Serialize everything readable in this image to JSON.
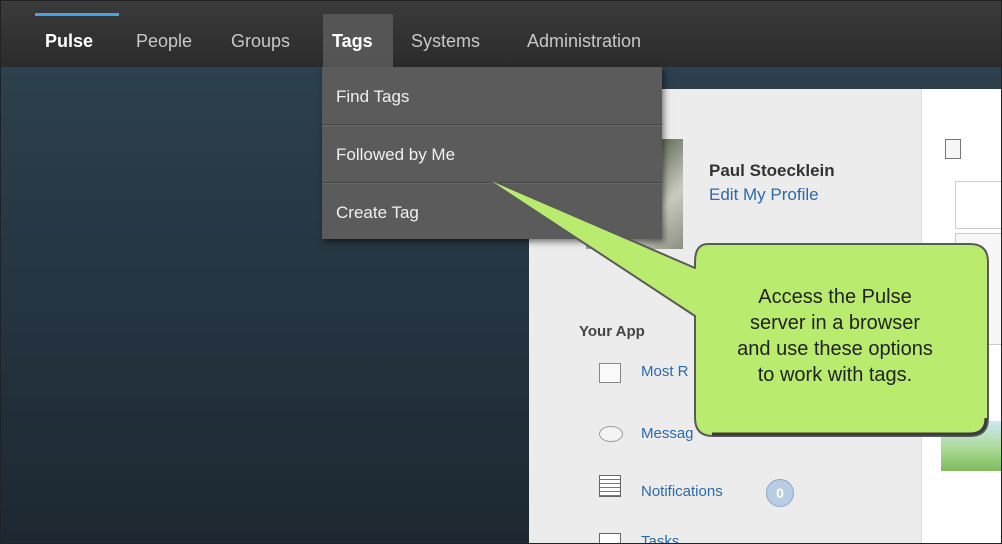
{
  "nav": {
    "items": [
      {
        "label": "Pulse"
      },
      {
        "label": "People"
      },
      {
        "label": "Groups"
      },
      {
        "label": "Tags"
      },
      {
        "label": "Systems"
      },
      {
        "label": "Administration"
      }
    ],
    "active": "Pulse",
    "open_menu": "Tags"
  },
  "tags_menu": {
    "items": [
      {
        "label": "Find Tags"
      },
      {
        "label": "Followed by Me"
      },
      {
        "label": "Create Tag"
      }
    ]
  },
  "profile": {
    "name": "Paul Stoecklein",
    "edit_label": "Edit My Profile"
  },
  "apps": {
    "heading": "Your App",
    "items": [
      {
        "label": "Most R",
        "icon": "document-icon"
      },
      {
        "label": "Messag",
        "icon": "message-icon"
      },
      {
        "label": "Notifications",
        "icon": "notifications-icon",
        "badge": "0"
      },
      {
        "label": "Tasks",
        "icon": "tasks-icon"
      }
    ]
  },
  "callout": {
    "text_lines": [
      "Access the Pulse",
      "server in a browser",
      "and use these options",
      "to work with tags."
    ]
  },
  "colors": {
    "navbar": "#2f2f2f",
    "accent": "#4aa3df",
    "menu_bg": "#5b5b5b",
    "callout_fill": "#b9ec6e",
    "link": "#2c6aa8"
  }
}
